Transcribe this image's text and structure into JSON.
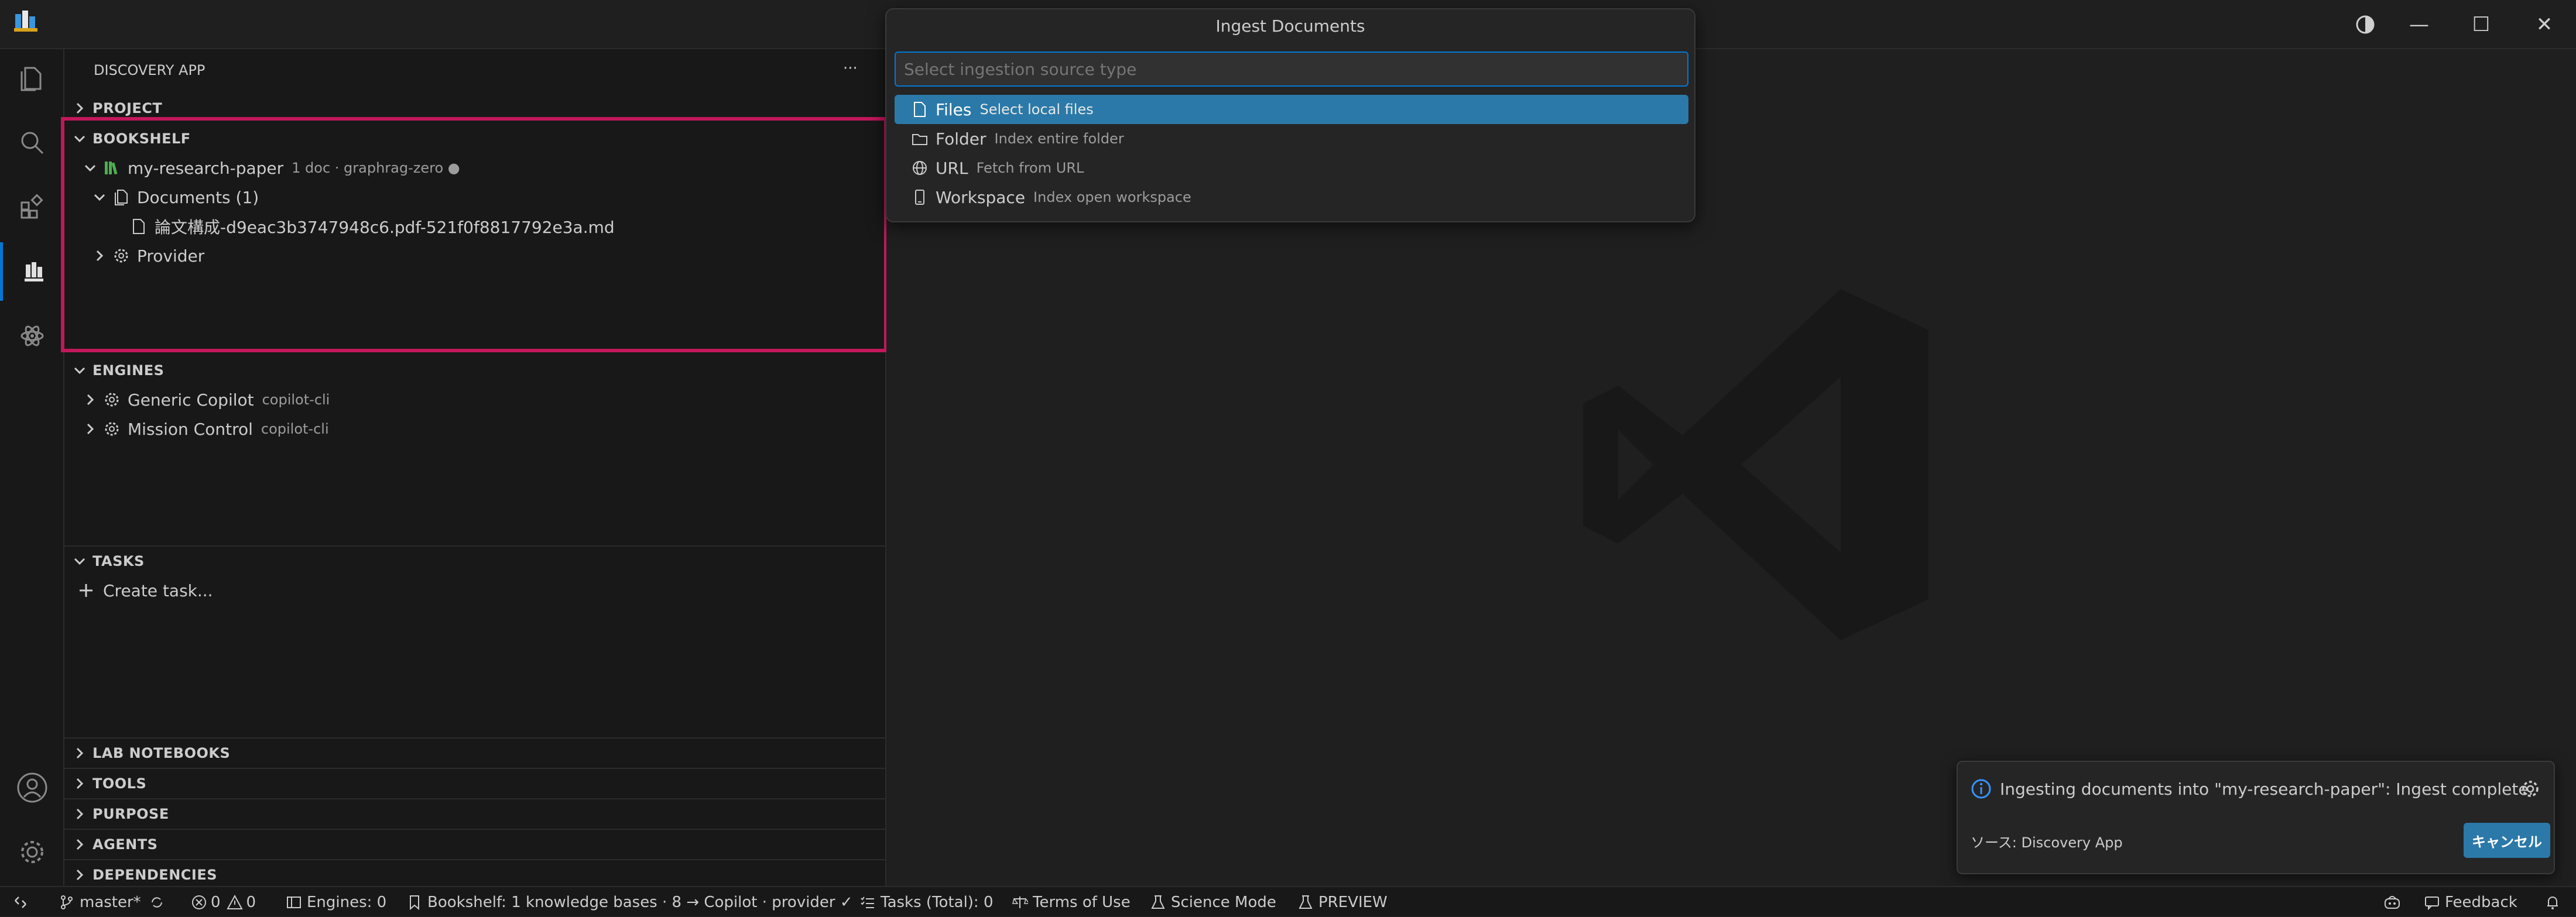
{
  "window": {
    "minimize_glyph": "—",
    "maximize_glyph": "☐",
    "close_glyph": "✕"
  },
  "sidebar": {
    "title": "DISCOVERY APP",
    "more_glyph": "···",
    "project": {
      "label": "PROJECT"
    },
    "bookshelf": {
      "label": "BOOKSHELF",
      "kb_name": "my-research-paper",
      "kb_desc": "1 doc · graphrag-zero ●",
      "documents_label": "Documents (1)",
      "file_name": "論文構成-d9eac3b3747948c6.pdf-521f0f8817792e3a.md",
      "provider_label": "Provider"
    },
    "engines": {
      "label": "ENGINES",
      "items": [
        {
          "name": "Generic Copilot",
          "desc": "copilot-cli"
        },
        {
          "name": "Mission Control",
          "desc": "copilot-cli"
        }
      ]
    },
    "tasks": {
      "label": "TASKS",
      "create": "Create task..."
    },
    "bottom_sections": [
      "LAB NOTEBOOKS",
      "TOOLS",
      "PURPOSE",
      "AGENTS",
      "DEPENDENCIES"
    ]
  },
  "quickpick": {
    "title": "Ingest Documents",
    "placeholder": "Select ingestion source type",
    "items": [
      {
        "label": "Files",
        "desc": "Select local files",
        "icon": "file-icon"
      },
      {
        "label": "Folder",
        "desc": "Index entire folder",
        "icon": "folder-icon"
      },
      {
        "label": "URL",
        "desc": "Fetch from URL",
        "icon": "globe-icon"
      },
      {
        "label": "Workspace",
        "desc": "Index open workspace",
        "icon": "device-icon"
      }
    ]
  },
  "notification": {
    "message": "Ingesting documents into \"my-research-paper\": Ingest complete.",
    "source": "ソース: Discovery App",
    "cancel": "キャンセル"
  },
  "statusbar": {
    "branch": "master*",
    "errors": "0",
    "warnings": "0",
    "engines": "Engines: 0",
    "bookshelf": "Bookshelf: 1 knowledge bases · 8 → Copilot · provider ✓",
    "tasks": "Tasks (Total): 0",
    "terms": "Terms of Use",
    "science": "Science Mode",
    "preview": "PREVIEW",
    "feedback": "Feedback"
  },
  "colors": {
    "accent": "#0078d4",
    "selection": "#2b79a8",
    "highlight_border": "#c2185b",
    "kb_icon": "#4caf50"
  }
}
